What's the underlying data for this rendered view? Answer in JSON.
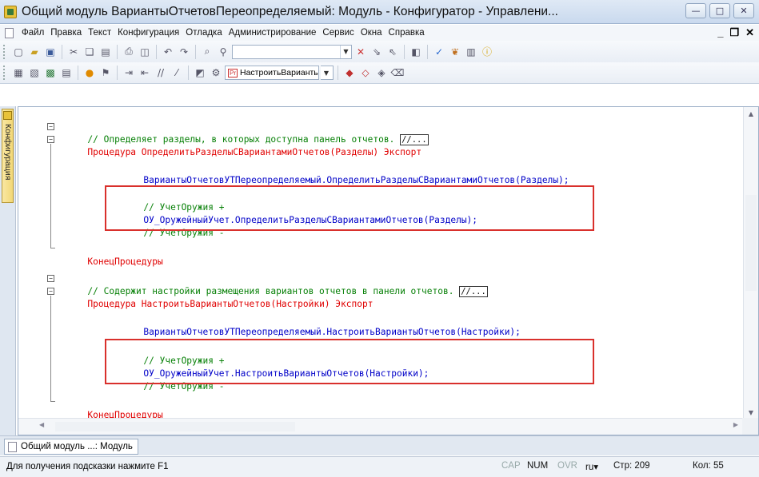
{
  "window": {
    "title": "Общий модуль ВариантыОтчетовПереопределяемый: Модуль - Конфигуратор - Управлени...",
    "buttons": {
      "minimize": "—",
      "maximize": "□",
      "close": "✕"
    }
  },
  "menubar": {
    "items": [
      "Файл",
      "Правка",
      "Текст",
      "Конфигурация",
      "Отладка",
      "Администрирование",
      "Сервис",
      "Окна",
      "Справка"
    ],
    "right": {
      "minimize": "_",
      "restore": "❐",
      "close": "✕"
    }
  },
  "toolbar": {
    "search_value": "",
    "procedure_tag": "Pr",
    "procedure_value": "НастроитьВариантыОтч"
  },
  "sidepanel": {
    "tab_label": "Конфигурация"
  },
  "code": {
    "comment1": "// Определяет разделы, в которых доступна панель отчетов.",
    "ellipsis": "//...",
    "proc1_kw": "Процедура",
    "proc1_name": "ОпределитьРазделыСВариантамиОтчетов",
    "proc1_params": "(Разделы)",
    "export_kw": "Экспорт",
    "call1": "ВариантыОтчетовУТПереопределяемый.ОпределитьРазделыСВариантамиОтчетов(Разделы);",
    "mark_begin": "// УчетОружия +",
    "ou_call1": "ОУ_ОружейныйУчет.ОпределитьРазделыСВариантамиОтчетов(Разделы);",
    "mark_end": "// УчетОружия -",
    "end_proc": "КонецПроцедуры",
    "comment2": "// Содержит настройки размещения вариантов отчетов в панели отчетов.",
    "proc2_kw": "Процедура",
    "proc2_name": "НастроитьВариантыОтчетов",
    "proc2_params": "(Настройки)",
    "call2": "ВариантыОтчетовУТПереопределяемый.НастроитьВариантыОтчетов(Настройки);",
    "ou_call2": "ОУ_ОружейныйУчет.НастроитьВариантыОтчетов(Настройки);"
  },
  "tabs": {
    "active": "Общий модуль ...: Модуль"
  },
  "status": {
    "hint": "Для получения подсказки нажмите F1",
    "cap": "CAP",
    "num": "NUM",
    "ovr": "OVR",
    "lang": "ru▾",
    "line": "Стр: 209",
    "col": "Кол: 55"
  },
  "colors": {
    "comment": "#078007",
    "keyword": "#e00000",
    "identifier": "#0000c8",
    "highlight_border": "#d9302c"
  }
}
